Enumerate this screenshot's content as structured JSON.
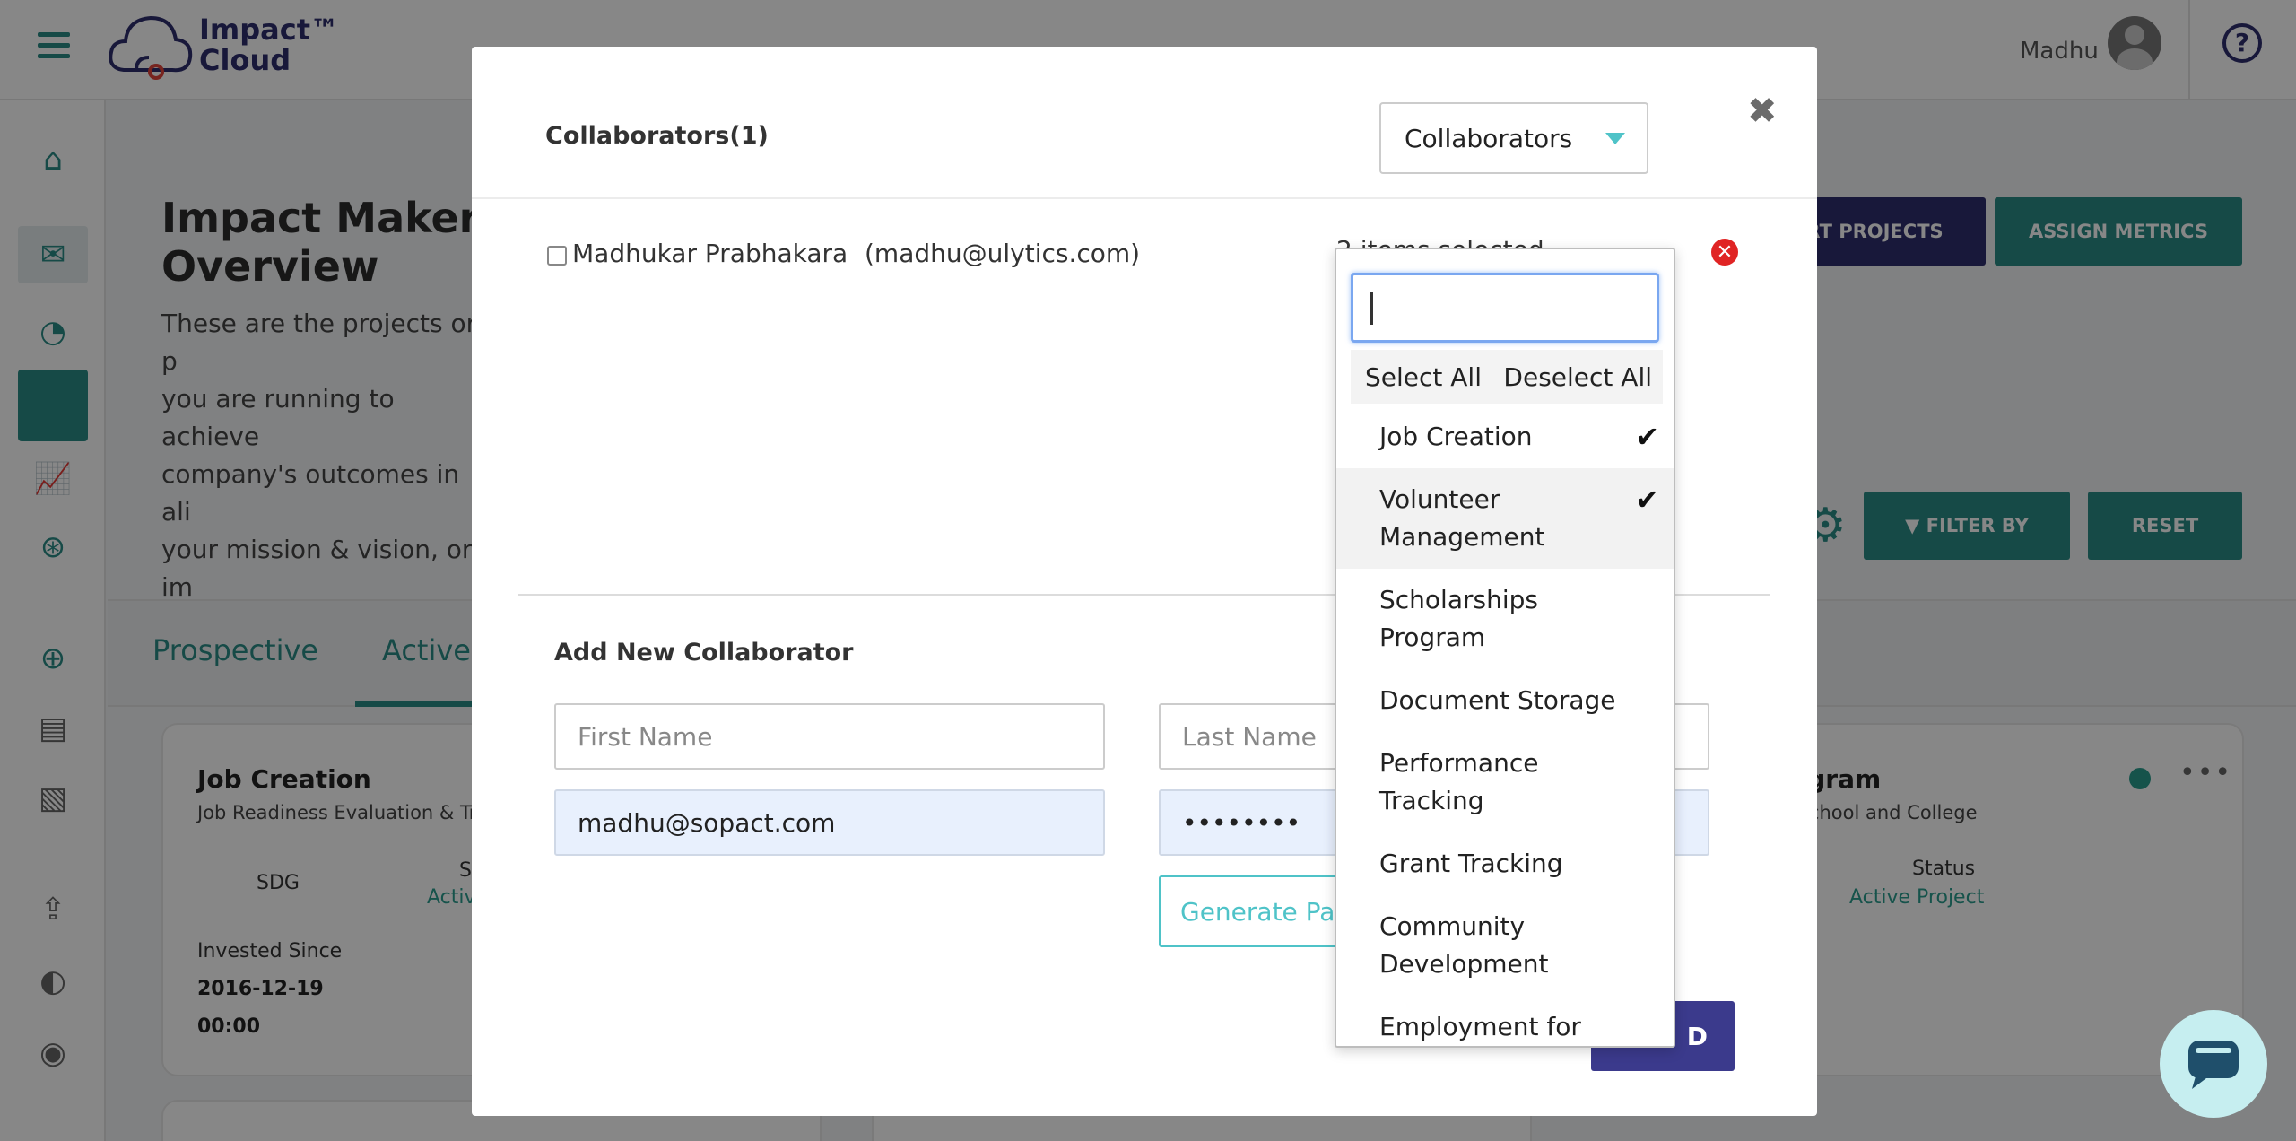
{
  "app": {
    "brand_line1": "Impact™",
    "brand_line2": "Cloud",
    "user_name": "Madhu"
  },
  "page": {
    "title": "Impact Maker Overview",
    "description": "These are the projects or p\nyou are running to achieve\ncompany's outcomes in ali\nyour mission & vision, or im",
    "buttons": {
      "import_projects": "RT PROJECTS",
      "assign_metrics": "ASSIGN METRICS",
      "filter_by": "FILTER BY",
      "reset": "RESET"
    },
    "tabs": [
      "Prospective",
      "Active"
    ],
    "cards": [
      {
        "title": "Job Creation",
        "subtitle": "Job Readiness Evaluation & Tr",
        "sdg_label": "SDG",
        "status_label": "S",
        "status_value": "Activ",
        "invested_label": "Invested Since",
        "invested_date": "2016-12-19",
        "invested_time": "00:00"
      },
      {
        "title": "ogram",
        "subtitle": "-School and College",
        "status_label": "Status",
        "status_value": "Active Project"
      }
    ]
  },
  "modal": {
    "title": "Collaborators(1)",
    "role_select": "Collaborators",
    "collaborator": {
      "name": "Madhukar Prabhakara",
      "email": "(madhu@ulytics.com)",
      "programs_summary": "2 items selected"
    },
    "add_section": {
      "title": "Add New Collaborator",
      "first_name_placeholder": "First Name",
      "last_name_placeholder": "Last Name",
      "email_value": "madhu@sopact.com",
      "password_value": "••••••••",
      "generate_password": "Generate Pas",
      "save": "D"
    }
  },
  "dropdown": {
    "search_value": "",
    "select_all": "Select All",
    "deselect_all": "Deselect All",
    "items": [
      {
        "label": "Job Creation",
        "checked": true
      },
      {
        "label": "Volunteer Management",
        "checked": true
      },
      {
        "label": "Scholarships Program",
        "checked": false
      },
      {
        "label": "Document Storage",
        "checked": false
      },
      {
        "label": "Performance Tracking",
        "checked": false
      },
      {
        "label": "Grant Tracking",
        "checked": false
      },
      {
        "label": "Community Development",
        "checked": false
      },
      {
        "label": "Employment for PWD",
        "checked": false
      }
    ]
  },
  "colors": {
    "teal": "#2a8c86",
    "navy": "#2e2f6e",
    "accent_cyan": "#4fc3c8",
    "purple_button": "#3b3a8c",
    "danger": "#e02424"
  }
}
